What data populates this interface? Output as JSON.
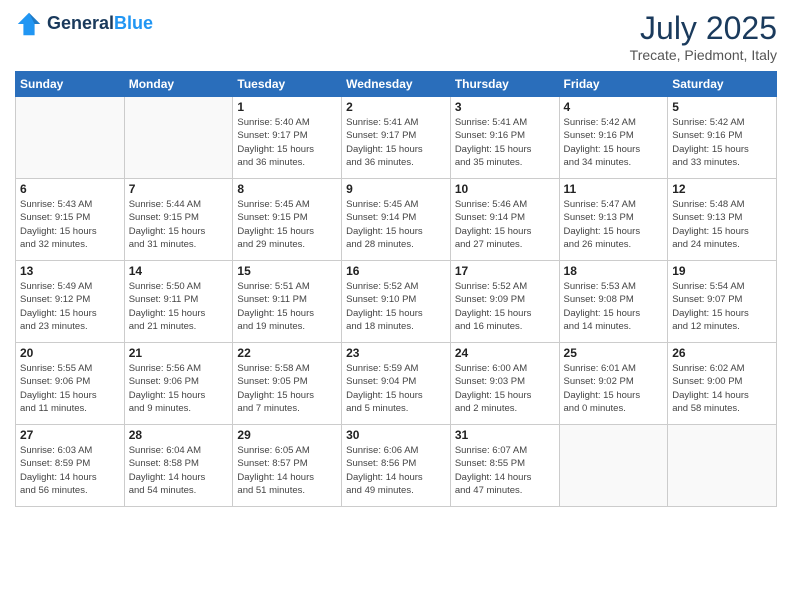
{
  "logo": {
    "line1": "General",
    "line2": "Blue"
  },
  "header": {
    "month": "July 2025",
    "location": "Trecate, Piedmont, Italy"
  },
  "weekdays": [
    "Sunday",
    "Monday",
    "Tuesday",
    "Wednesday",
    "Thursday",
    "Friday",
    "Saturday"
  ],
  "weeks": [
    [
      {
        "day": "",
        "text": ""
      },
      {
        "day": "",
        "text": ""
      },
      {
        "day": "1",
        "text": "Sunrise: 5:40 AM\nSunset: 9:17 PM\nDaylight: 15 hours\nand 36 minutes."
      },
      {
        "day": "2",
        "text": "Sunrise: 5:41 AM\nSunset: 9:17 PM\nDaylight: 15 hours\nand 36 minutes."
      },
      {
        "day": "3",
        "text": "Sunrise: 5:41 AM\nSunset: 9:16 PM\nDaylight: 15 hours\nand 35 minutes."
      },
      {
        "day": "4",
        "text": "Sunrise: 5:42 AM\nSunset: 9:16 PM\nDaylight: 15 hours\nand 34 minutes."
      },
      {
        "day": "5",
        "text": "Sunrise: 5:42 AM\nSunset: 9:16 PM\nDaylight: 15 hours\nand 33 minutes."
      }
    ],
    [
      {
        "day": "6",
        "text": "Sunrise: 5:43 AM\nSunset: 9:15 PM\nDaylight: 15 hours\nand 32 minutes."
      },
      {
        "day": "7",
        "text": "Sunrise: 5:44 AM\nSunset: 9:15 PM\nDaylight: 15 hours\nand 31 minutes."
      },
      {
        "day": "8",
        "text": "Sunrise: 5:45 AM\nSunset: 9:15 PM\nDaylight: 15 hours\nand 29 minutes."
      },
      {
        "day": "9",
        "text": "Sunrise: 5:45 AM\nSunset: 9:14 PM\nDaylight: 15 hours\nand 28 minutes."
      },
      {
        "day": "10",
        "text": "Sunrise: 5:46 AM\nSunset: 9:14 PM\nDaylight: 15 hours\nand 27 minutes."
      },
      {
        "day": "11",
        "text": "Sunrise: 5:47 AM\nSunset: 9:13 PM\nDaylight: 15 hours\nand 26 minutes."
      },
      {
        "day": "12",
        "text": "Sunrise: 5:48 AM\nSunset: 9:13 PM\nDaylight: 15 hours\nand 24 minutes."
      }
    ],
    [
      {
        "day": "13",
        "text": "Sunrise: 5:49 AM\nSunset: 9:12 PM\nDaylight: 15 hours\nand 23 minutes."
      },
      {
        "day": "14",
        "text": "Sunrise: 5:50 AM\nSunset: 9:11 PM\nDaylight: 15 hours\nand 21 minutes."
      },
      {
        "day": "15",
        "text": "Sunrise: 5:51 AM\nSunset: 9:11 PM\nDaylight: 15 hours\nand 19 minutes."
      },
      {
        "day": "16",
        "text": "Sunrise: 5:52 AM\nSunset: 9:10 PM\nDaylight: 15 hours\nand 18 minutes."
      },
      {
        "day": "17",
        "text": "Sunrise: 5:52 AM\nSunset: 9:09 PM\nDaylight: 15 hours\nand 16 minutes."
      },
      {
        "day": "18",
        "text": "Sunrise: 5:53 AM\nSunset: 9:08 PM\nDaylight: 15 hours\nand 14 minutes."
      },
      {
        "day": "19",
        "text": "Sunrise: 5:54 AM\nSunset: 9:07 PM\nDaylight: 15 hours\nand 12 minutes."
      }
    ],
    [
      {
        "day": "20",
        "text": "Sunrise: 5:55 AM\nSunset: 9:06 PM\nDaylight: 15 hours\nand 11 minutes."
      },
      {
        "day": "21",
        "text": "Sunrise: 5:56 AM\nSunset: 9:06 PM\nDaylight: 15 hours\nand 9 minutes."
      },
      {
        "day": "22",
        "text": "Sunrise: 5:58 AM\nSunset: 9:05 PM\nDaylight: 15 hours\nand 7 minutes."
      },
      {
        "day": "23",
        "text": "Sunrise: 5:59 AM\nSunset: 9:04 PM\nDaylight: 15 hours\nand 5 minutes."
      },
      {
        "day": "24",
        "text": "Sunrise: 6:00 AM\nSunset: 9:03 PM\nDaylight: 15 hours\nand 2 minutes."
      },
      {
        "day": "25",
        "text": "Sunrise: 6:01 AM\nSunset: 9:02 PM\nDaylight: 15 hours\nand 0 minutes."
      },
      {
        "day": "26",
        "text": "Sunrise: 6:02 AM\nSunset: 9:00 PM\nDaylight: 14 hours\nand 58 minutes."
      }
    ],
    [
      {
        "day": "27",
        "text": "Sunrise: 6:03 AM\nSunset: 8:59 PM\nDaylight: 14 hours\nand 56 minutes."
      },
      {
        "day": "28",
        "text": "Sunrise: 6:04 AM\nSunset: 8:58 PM\nDaylight: 14 hours\nand 54 minutes."
      },
      {
        "day": "29",
        "text": "Sunrise: 6:05 AM\nSunset: 8:57 PM\nDaylight: 14 hours\nand 51 minutes."
      },
      {
        "day": "30",
        "text": "Sunrise: 6:06 AM\nSunset: 8:56 PM\nDaylight: 14 hours\nand 49 minutes."
      },
      {
        "day": "31",
        "text": "Sunrise: 6:07 AM\nSunset: 8:55 PM\nDaylight: 14 hours\nand 47 minutes."
      },
      {
        "day": "",
        "text": ""
      },
      {
        "day": "",
        "text": ""
      }
    ]
  ]
}
